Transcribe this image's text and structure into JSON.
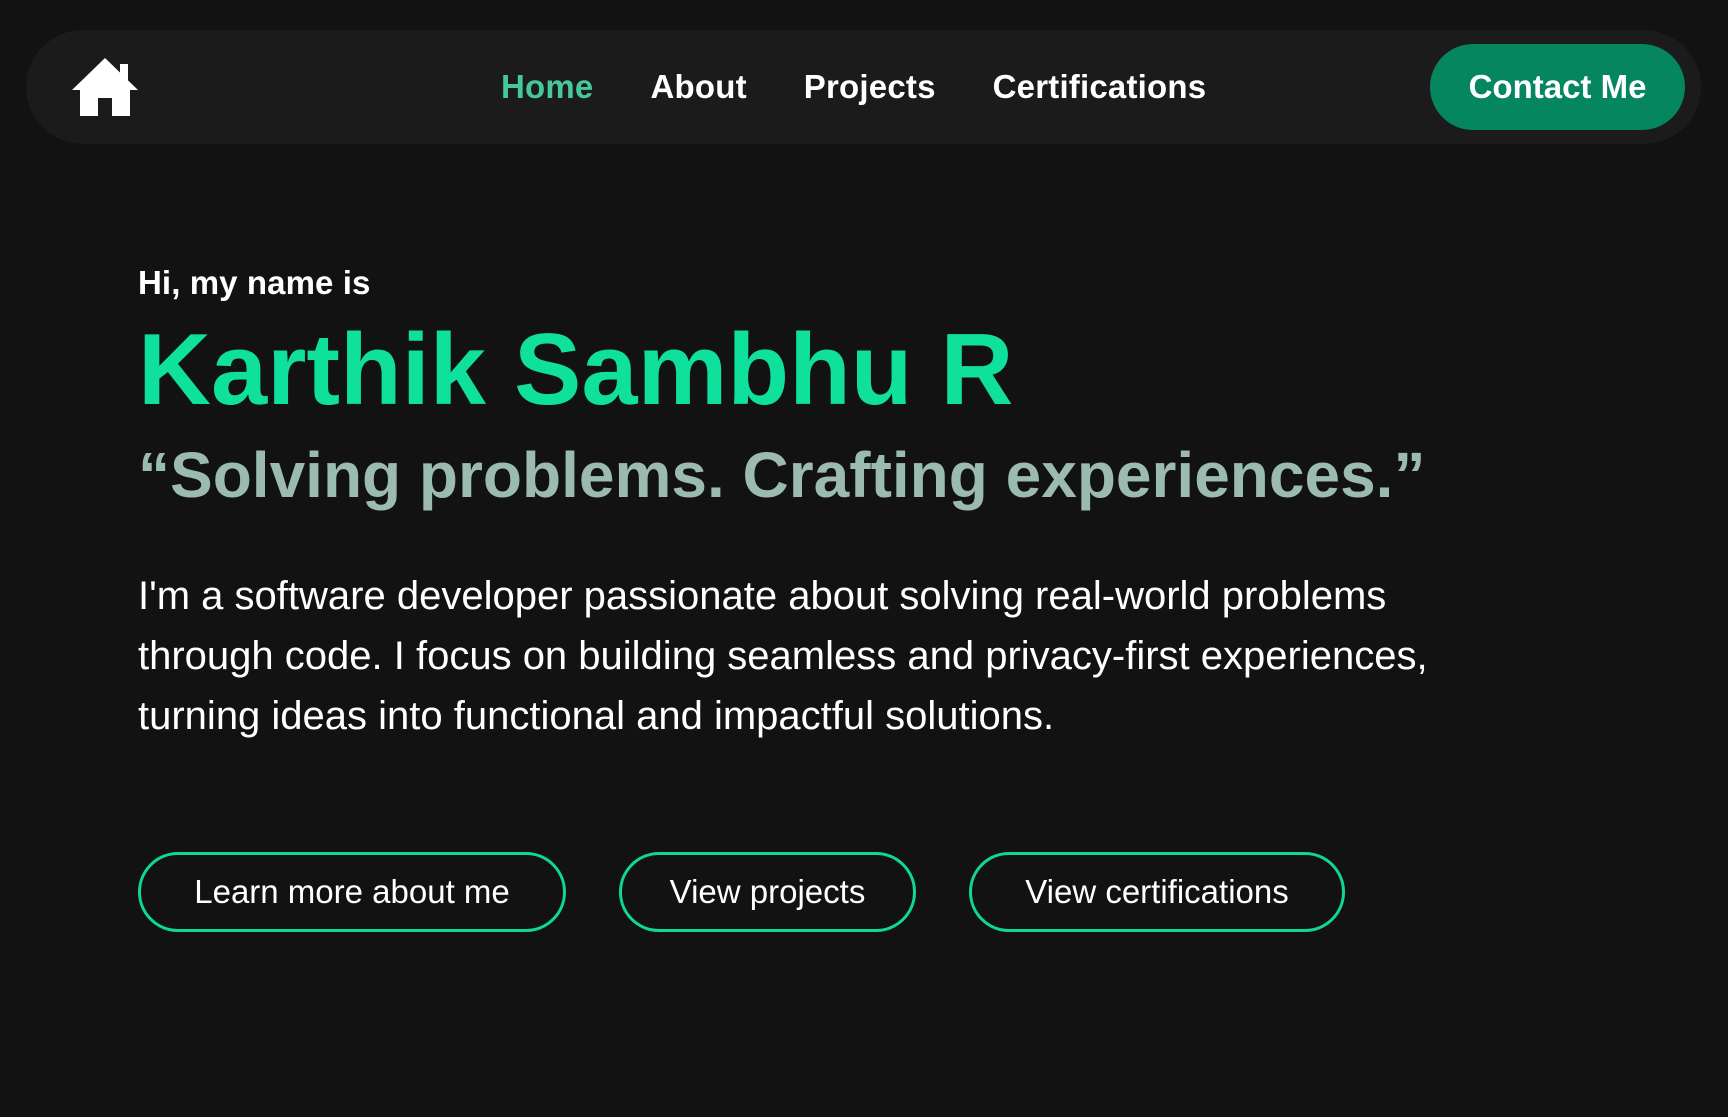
{
  "navigation": {
    "home_icon": "home-icon",
    "links": [
      {
        "label": "Home",
        "state": "active"
      },
      {
        "label": "About",
        "state": "default"
      },
      {
        "label": "Projects",
        "state": "default"
      },
      {
        "label": "Certifications",
        "state": "default"
      }
    ],
    "contact_label": "Contact Me"
  },
  "hero": {
    "greeting": "Hi, my name is",
    "name": "Karthik Sambhu R",
    "tagline": "“Solving problems. Crafting experiences.”",
    "intro": "I'm a software developer passionate about solving real-world problems through code. I focus on building seamless and privacy-first experiences, turning ideas into functional and impactful solutions."
  },
  "actions": [
    {
      "label": "Learn more about me"
    },
    {
      "label": "View projects"
    },
    {
      "label": "View certifications"
    }
  ],
  "colors": {
    "background": "#121212",
    "navbar_background": "#1b1b1b",
    "active_nav": "#46c79c",
    "contact_button": "#06865f",
    "name_accent": "#0fe09b",
    "tagline": "#9bbab0",
    "button_outline": "#0fd79a"
  }
}
